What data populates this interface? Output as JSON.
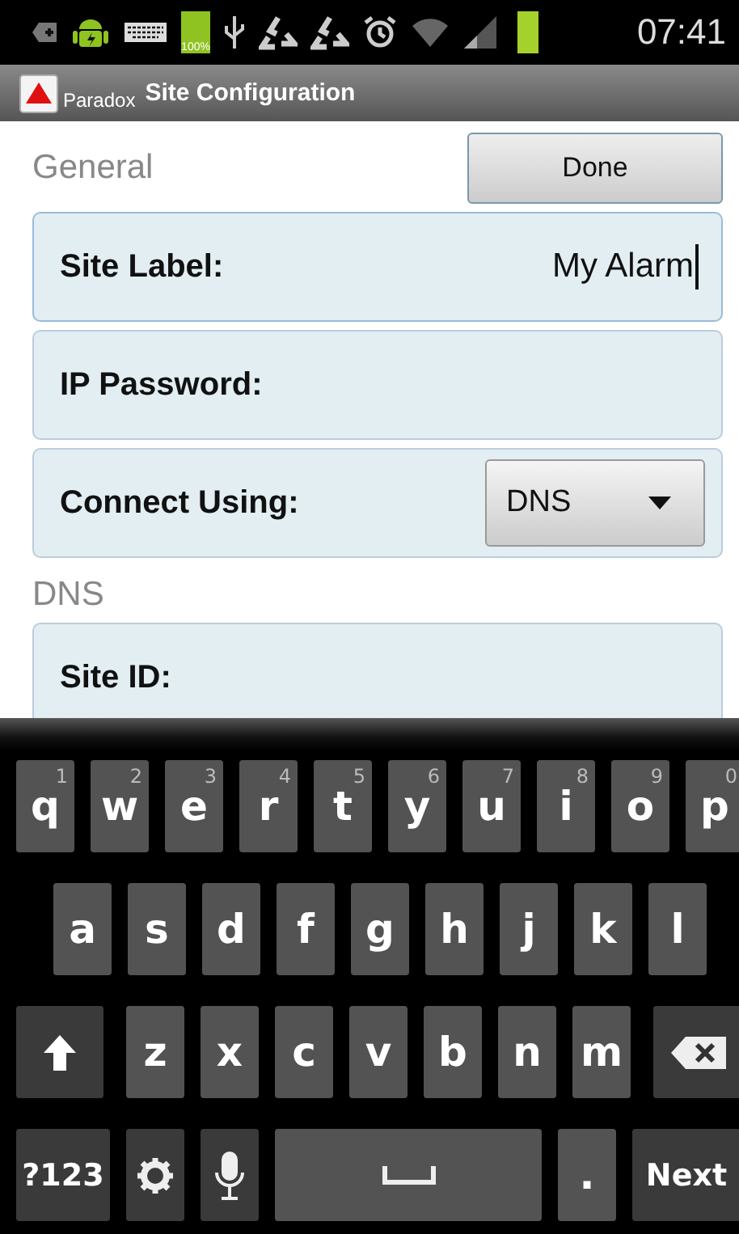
{
  "status_bar": {
    "battery_label": "100%",
    "time": "07:41"
  },
  "action_bar": {
    "app_name": "Paradox",
    "title": "Site Configuration"
  },
  "general": {
    "heading": "General",
    "done_button": "Done"
  },
  "fields": [
    {
      "kind": "text",
      "label": "Site Label:",
      "value": "My Alarm",
      "focused": true
    },
    {
      "kind": "text",
      "label": "IP Password:",
      "focused": false
    },
    {
      "kind": "dropdown",
      "label": "Connect Using:",
      "value": "DNS"
    }
  ],
  "dns": {
    "heading": "DNS",
    "fields": [
      {
        "label": "Site ID:",
        "focused": false
      }
    ]
  },
  "keyboard": {
    "rows": [
      {
        "keys": [
          {
            "kind": "letter",
            "label": "q",
            "hint": "1"
          },
          {
            "kind": "letter",
            "label": "w",
            "hint": "2"
          },
          {
            "kind": "letter",
            "label": "e",
            "hint": "3"
          },
          {
            "kind": "letter",
            "label": "r",
            "hint": "4"
          },
          {
            "kind": "letter",
            "label": "t",
            "hint": "5"
          },
          {
            "kind": "letter",
            "label": "y",
            "hint": "6"
          },
          {
            "kind": "letter",
            "label": "u",
            "hint": "7"
          },
          {
            "kind": "letter",
            "label": "i",
            "hint": "8"
          },
          {
            "kind": "letter",
            "label": "o",
            "hint": "9"
          },
          {
            "kind": "letter",
            "label": "p",
            "hint": "0"
          }
        ]
      },
      {
        "keys": [
          {
            "kind": "letter",
            "label": "a"
          },
          {
            "kind": "letter",
            "label": "s"
          },
          {
            "kind": "letter",
            "label": "d"
          },
          {
            "kind": "letter",
            "label": "f"
          },
          {
            "kind": "letter",
            "label": "g"
          },
          {
            "kind": "letter",
            "label": "h"
          },
          {
            "kind": "letter",
            "label": "j"
          },
          {
            "kind": "letter",
            "label": "k"
          },
          {
            "kind": "letter",
            "label": "l"
          }
        ]
      },
      {
        "keys": [
          {
            "kind": "shift"
          },
          {
            "kind": "letter",
            "label": "z"
          },
          {
            "kind": "letter",
            "label": "x"
          },
          {
            "kind": "letter",
            "label": "c"
          },
          {
            "kind": "letter",
            "label": "v"
          },
          {
            "kind": "letter",
            "label": "b"
          },
          {
            "kind": "letter",
            "label": "n"
          },
          {
            "kind": "letter",
            "label": "m"
          },
          {
            "kind": "backspace"
          }
        ]
      },
      {
        "keys": [
          {
            "kind": "symbols",
            "label": "?123"
          },
          {
            "kind": "settings"
          },
          {
            "kind": "mic"
          },
          {
            "kind": "space"
          },
          {
            "kind": "period",
            "label": "."
          },
          {
            "kind": "action",
            "label": "Next"
          }
        ]
      }
    ]
  }
}
